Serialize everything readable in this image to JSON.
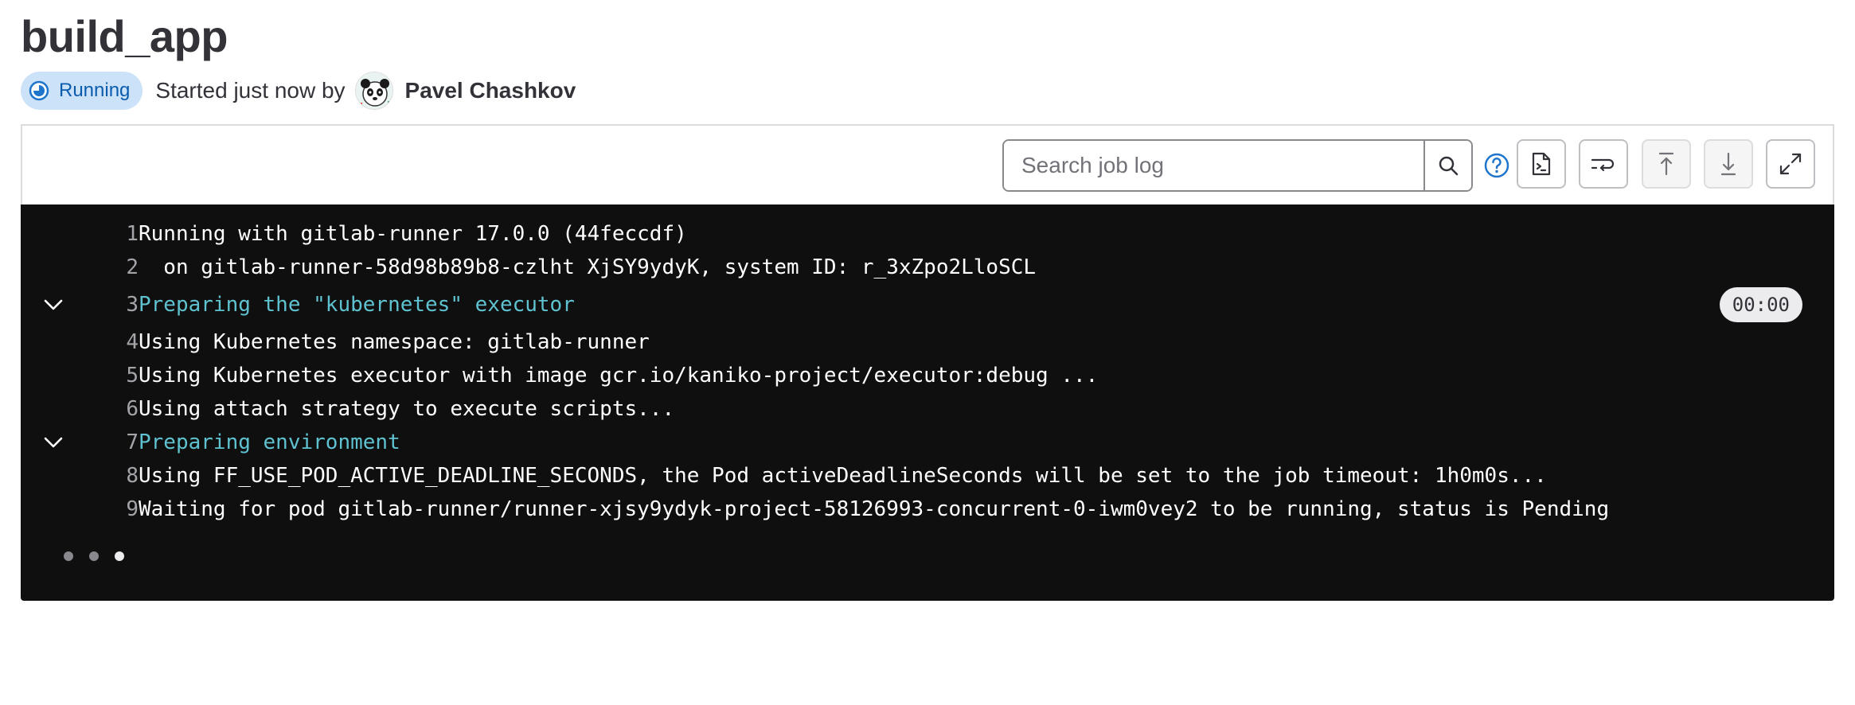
{
  "job": {
    "title": "build_app",
    "status_label": "Running",
    "started_text": "Started just now by",
    "author": "Pavel Chashkov"
  },
  "toolbar": {
    "search_placeholder": "Search job log"
  },
  "log": {
    "lines": [
      {
        "num": "1",
        "text": "Running with gitlab-runner 17.0.0 (44feccdf)"
      },
      {
        "num": "2",
        "text": "  on gitlab-runner-58d98b89b8-czlht XjSY9ydyK, system ID: r_3xZpo2LloSCL"
      },
      {
        "num": "3",
        "text": "Preparing the \"kubernetes\" executor",
        "duration": "00:00"
      },
      {
        "num": "4",
        "text": "Using Kubernetes namespace: gitlab-runner"
      },
      {
        "num": "5",
        "text": "Using Kubernetes executor with image gcr.io/kaniko-project/executor:debug ..."
      },
      {
        "num": "6",
        "text": "Using attach strategy to execute scripts..."
      },
      {
        "num": "7",
        "text": "Preparing environment"
      },
      {
        "num": "8",
        "text": "Using FF_USE_POD_ACTIVE_DEADLINE_SECONDS, the Pod activeDeadlineSeconds will be set to the job timeout: 1h0m0s..."
      },
      {
        "num": "9",
        "text": "Waiting for pod gitlab-runner/runner-xjsy9ydyk-project-58126993-concurrent-0-iwm0vey2 to be running, status is Pending"
      }
    ]
  },
  "icons": {
    "status": "status-running-icon",
    "search": "search-icon",
    "help": "question-circle-icon",
    "raw": "doc-code-icon",
    "wrap": "text-wrap-icon",
    "scroll_top": "scroll-up-icon",
    "scroll_bottom": "scroll-down-icon",
    "fullscreen": "maximize-icon",
    "section_toggle": "chevron-down-icon"
  },
  "colors": {
    "running_bg": "#cbe2f9",
    "running_fg": "#0b5cad",
    "log_bg": "#0f0f0f",
    "section_header": "#5fc2d0",
    "help_blue": "#1f75cb"
  }
}
